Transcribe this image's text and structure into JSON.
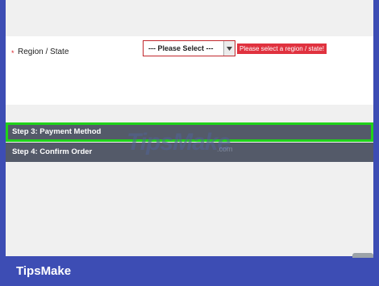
{
  "form": {
    "required_mark": "*",
    "region_label": "Region / State",
    "region_select_value": "--- Please Select ---",
    "region_error": "Please select a region / state!"
  },
  "steps": [
    {
      "label": "Step 3: Payment Method",
      "highlighted": true
    },
    {
      "label": "Step 4: Confirm Order",
      "highlighted": false
    }
  ],
  "watermark": {
    "text": "TipsMake",
    "suffix": ".com"
  },
  "footer": {
    "brand": "TipsMake"
  },
  "colors": {
    "background": "#3d4db4",
    "step_bar": "#545a69",
    "highlight": "#20d31a",
    "error": "#e0323f"
  }
}
